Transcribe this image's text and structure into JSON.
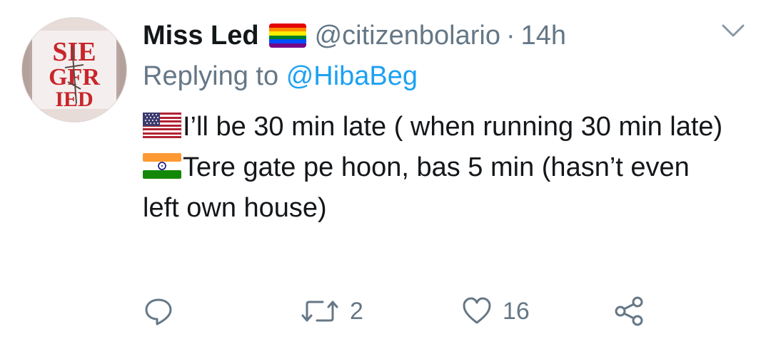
{
  "tweet": {
    "author_name": "Miss Led",
    "handle": "@citizenbolario",
    "separator": "·",
    "time": "14h",
    "replying_prefix": "Replying to",
    "replying_handle": "@HibaBeg",
    "line1_text": "I’ll be 30 min late ( when running 30 min late)",
    "line2_text": "Tere gate pe hoon, bas 5 min (hasn’t even left own house)",
    "author_flag_icon": "rainbow-flag-icon",
    "line1_flag_icon": "us-flag-icon",
    "line2_flag_icon": "india-flag-icon",
    "avatar_text": "SIEGFRIED"
  },
  "actions": {
    "reply_count": "",
    "retweet_count": "2",
    "like_count": "16"
  },
  "colors": {
    "text": "#14171a",
    "secondary": "#657786",
    "link": "#1da1f2"
  }
}
